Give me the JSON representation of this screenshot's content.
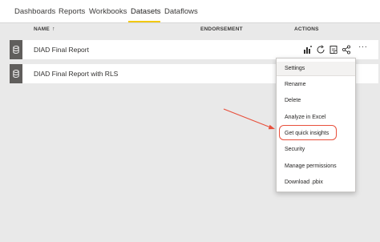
{
  "tabs": [
    {
      "label": "Dashboards"
    },
    {
      "label": "Reports"
    },
    {
      "label": "Workbooks"
    },
    {
      "label": "Datasets"
    },
    {
      "label": "Dataflows"
    }
  ],
  "active_tab": "Datasets",
  "columns": {
    "name": "NAME",
    "endorsement": "ENDORSEMENT",
    "actions": "ACTIONS"
  },
  "rows": [
    {
      "name": "DIAD Final Report"
    },
    {
      "name": "DIAD Final Report with RLS"
    }
  ],
  "actions_icons": [
    "create-report-icon",
    "refresh-icon",
    "schedule-refresh-icon",
    "share-icon",
    "more-options-icon"
  ],
  "menu": {
    "items": [
      {
        "label": "Settings"
      },
      {
        "label": "Rename"
      },
      {
        "label": "Delete"
      },
      {
        "label": "Analyze in Excel"
      },
      {
        "label": "Get quick insights"
      },
      {
        "label": "Security"
      },
      {
        "label": "Manage permissions"
      },
      {
        "label": "Download .pbix"
      }
    ],
    "highlighted": "Get quick insights"
  },
  "colors": {
    "accent_underline": "#f2c811",
    "annotation": "#e8503c",
    "row_icon_bg": "#605e5c"
  }
}
